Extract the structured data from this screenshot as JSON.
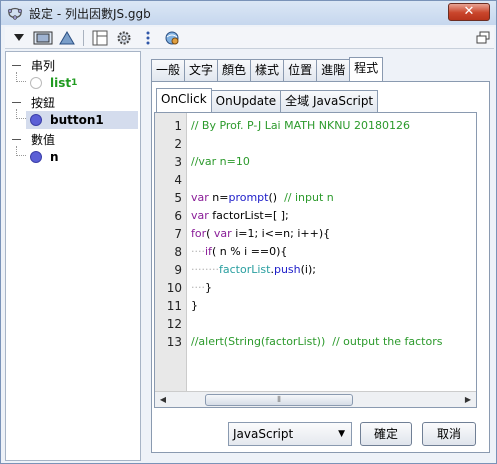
{
  "window": {
    "title": "設定 - 列出因數JS.ggb",
    "close_label": "✕"
  },
  "toolbar": {
    "icons": [
      "dropdown-arrow-icon",
      "display-icon",
      "triangle-icon",
      "panel-icon",
      "gear-icon",
      "more-icon",
      "globe-icon",
      "window-restore-icon"
    ]
  },
  "tree": {
    "groups": [
      {
        "label": "串列",
        "items": [
          {
            "label": "list",
            "subscript": "1",
            "dot": "open",
            "color": "#1f9a1f"
          }
        ]
      },
      {
        "label": "按鈕",
        "items": [
          {
            "label": "button1",
            "dot": "blue",
            "color": "#000000",
            "selected": true
          }
        ]
      },
      {
        "label": "數值",
        "items": [
          {
            "label": "n",
            "dot": "blue",
            "color": "#000000"
          }
        ]
      }
    ]
  },
  "tabs": [
    "一般",
    "文字",
    "顏色",
    "樣式",
    "位置",
    "進階",
    "程式"
  ],
  "active_tab": "程式",
  "subtabs": [
    "OnClick",
    "OnUpdate",
    "全域 JavaScript"
  ],
  "active_subtab": "OnClick",
  "code": {
    "lines": [
      {
        "n": "1",
        "text": "// By Prof. P-J Lai MATH NKNU 20180126"
      },
      {
        "n": "2",
        "text": ""
      },
      {
        "n": "3",
        "text": "//var n=10"
      },
      {
        "n": "4",
        "text": ""
      },
      {
        "n": "5",
        "text": "var n=prompt()  // input n"
      },
      {
        "n": "6",
        "text": "var factorList=[ ];"
      },
      {
        "n": "7",
        "text": "for( var i=1; i<=n; i++){"
      },
      {
        "n": "8",
        "text": "if( n % i ==0){"
      },
      {
        "n": "9",
        "text": "factorList.push(i);"
      },
      {
        "n": "10",
        "text": "}"
      },
      {
        "n": "11",
        "text": "}"
      },
      {
        "n": "12",
        "text": ""
      },
      {
        "n": "13",
        "text": "//alert(String(factorList))  // output the factors"
      }
    ]
  },
  "language_select": {
    "value": "JavaScript"
  },
  "buttons": {
    "ok": "確定",
    "cancel": "取消"
  },
  "colors": {
    "comment": "#2c9a2c",
    "keyword": "#8a1d98",
    "variable": "#1d1dc9",
    "accent": "#5b5fd6"
  }
}
